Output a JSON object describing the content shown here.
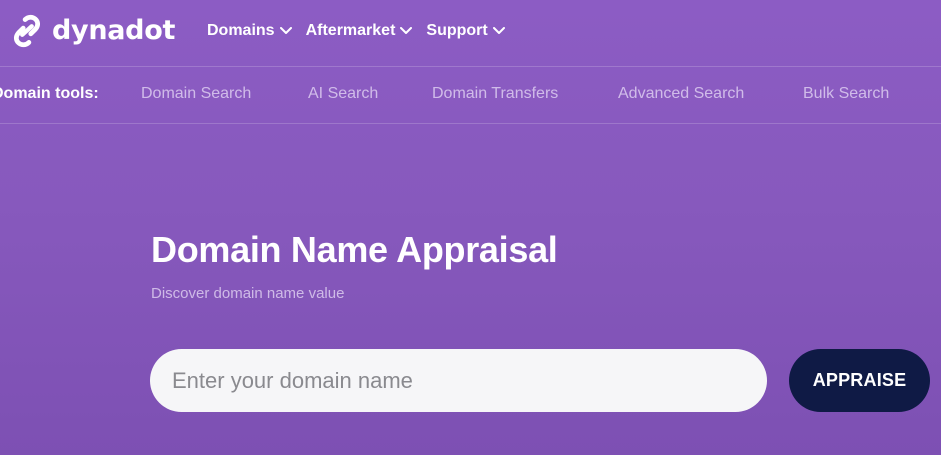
{
  "brand": {
    "name": "dynadot",
    "logo_icon": "chain-link-logo-icon"
  },
  "main_nav": [
    {
      "label": "Domains",
      "icon": "chevron-down-icon"
    },
    {
      "label": "Aftermarket",
      "icon": "chevron-down-icon"
    },
    {
      "label": "Support",
      "icon": "chevron-down-icon"
    }
  ],
  "sub_nav": {
    "label": "Domain tools:",
    "links": [
      "Domain Search",
      "AI Search",
      "Domain Transfers",
      "Advanced Search",
      "Bulk Search"
    ]
  },
  "hero": {
    "title": "Domain Name Appraisal",
    "subtitle": "Discover domain name value"
  },
  "search": {
    "placeholder": "Enter your domain name",
    "value": "",
    "button_label": "APPRAISE"
  },
  "colors": {
    "background": "#8759bd",
    "button": "#0f1a45",
    "input": "#f6f6f8"
  }
}
